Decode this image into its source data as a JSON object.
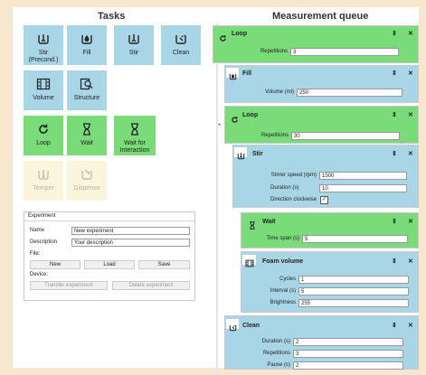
{
  "tasks_panel": {
    "title": "Tasks",
    "tiles": [
      {
        "label": "Stir\n(Precond.)",
        "icon": "stir-icon",
        "state": "blue"
      },
      {
        "label": "Fill",
        "icon": "drop-icon",
        "state": "blue"
      },
      {
        "label": "Stir",
        "icon": "stir-icon",
        "state": "blue"
      },
      {
        "label": "Clean",
        "icon": "clean-icon",
        "state": "blue"
      },
      {
        "label": "Volume",
        "icon": "volume-icon",
        "state": "blue"
      },
      {
        "label": "Structure",
        "icon": "structure-icon",
        "state": "blue"
      },
      {
        "label": "Loop",
        "icon": "loop-icon",
        "state": "green"
      },
      {
        "label": "Wait",
        "icon": "hourglass-icon",
        "state": "green"
      },
      {
        "label": "Wait for\nInteraction",
        "icon": "hourglass-icon",
        "state": "green"
      },
      {
        "label": "Temper",
        "icon": "temper-icon",
        "state": "disabled"
      },
      {
        "label": "Dispense",
        "icon": "dispense-icon",
        "state": "disabled"
      }
    ]
  },
  "experiment": {
    "header": "Experiment",
    "name_label": "Name",
    "name_value": "New experiment",
    "description_label": "Description",
    "description_value": "Your description",
    "file_label": "File:",
    "new_label": "New",
    "load_label": "Load",
    "save_label": "Save",
    "device_label": "Device:",
    "transfer_label": "Transfer experiment",
    "delete_label": "Delete experiment"
  },
  "queue": {
    "title": "Measurement queue",
    "items": [
      {
        "title": "Loop",
        "fields": [
          {
            "label": "Repetitions",
            "value": "3"
          }
        ]
      },
      {
        "title": "Fill",
        "fields": [
          {
            "label": "Volume (ml)",
            "value": "250"
          }
        ]
      },
      {
        "title": "Loop",
        "fields": [
          {
            "label": "Repetitions",
            "value": "30"
          }
        ]
      },
      {
        "title": "Stir",
        "fields": [
          {
            "label": "Stirrer speed (rpm)",
            "value": "1500"
          },
          {
            "label": "Duration (s)",
            "value": "10"
          }
        ],
        "checkbox_label": "Direction clockwise"
      },
      {
        "title": "Wait",
        "fields": [
          {
            "label": "Time span (s)",
            "value": "5"
          }
        ]
      },
      {
        "title": "Foam volume",
        "fields": [
          {
            "label": "Cycles",
            "value": "1"
          },
          {
            "label": "Interval (s)",
            "value": "5"
          },
          {
            "label": "Brightness",
            "value": "255"
          }
        ]
      },
      {
        "title": "Clean",
        "fields": [
          {
            "label": "Duration (s)",
            "value": "2"
          },
          {
            "label": "Repetitions",
            "value": "3"
          },
          {
            "label": "Pause (s)",
            "value": "2"
          }
        ]
      }
    ],
    "reorder_glyph": "⇕",
    "close_glyph": "✕"
  },
  "colors": {
    "task_blue": "#a9d6e6",
    "control_green": "#79dc79",
    "disabled": "#fbf5de",
    "background": "#f7e7cf"
  }
}
